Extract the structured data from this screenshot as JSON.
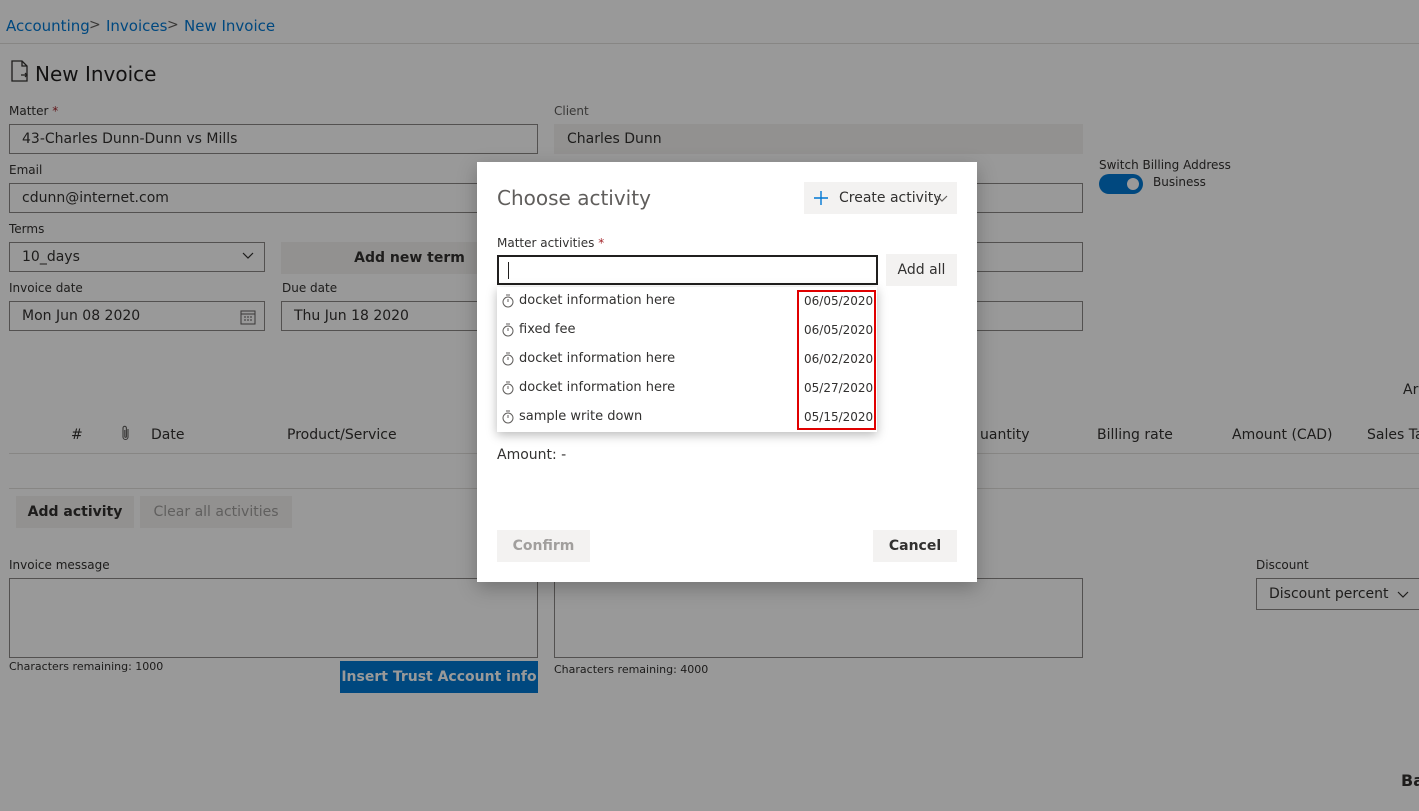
{
  "breadcrumb": {
    "items": [
      "Accounting",
      "Invoices",
      "New Invoice"
    ],
    "separator": ">"
  },
  "page": {
    "title": "New Invoice",
    "title_icon": "document-icon"
  },
  "form": {
    "matter": {
      "label": "Matter",
      "required_mark": "*",
      "value": "43-Charles Dunn-Dunn vs Mills"
    },
    "client": {
      "label": "Client",
      "value": "Charles Dunn"
    },
    "email": {
      "label": "Email",
      "value": "cdunn@internet.com"
    },
    "switch_billing": {
      "label": "Switch Billing Address",
      "state_label": "Business"
    },
    "terms": {
      "label": "Terms",
      "value": "10_days",
      "add_label": "Add new term"
    },
    "invoice_date": {
      "label": "Invoice date",
      "value": "Mon Jun 08 2020"
    },
    "due_date": {
      "label": "Due date",
      "value": "Thu Jun 18 2020"
    }
  },
  "table": {
    "columns": [
      "#",
      "Date",
      "Product/Service",
      "Quantity",
      "Billing rate",
      "Amount (CAD)",
      "Sales Tax"
    ],
    "cut_column_text": "Ar",
    "quantity_fragment": "uantity",
    "salestax_fragment": "Sales Tax"
  },
  "actions": {
    "add_activity": "Add activity",
    "clear_all": "Clear all activities"
  },
  "invoice_message": {
    "label": "Invoice message",
    "remaining": "Characters remaining: 1000"
  },
  "statement": {
    "remaining": "Characters remaining: 4000"
  },
  "insert_trust": "Insert Trust Account info",
  "discount": {
    "label": "Discount",
    "value": "Discount percent"
  },
  "bottom_right_fragment": "Ba",
  "dialog": {
    "title": "Choose activity",
    "create_label": "Create activity",
    "field_label": "Matter activities",
    "required_mark": "*",
    "search_value": "",
    "add_all": "Add all",
    "amount_label": "Amount: -",
    "confirm": "Confirm",
    "cancel": "Cancel",
    "activities": [
      {
        "name": "docket information here",
        "date": "06/05/2020"
      },
      {
        "name": "fixed fee",
        "date": "06/05/2020"
      },
      {
        "name": "docket information here",
        "date": "06/02/2020"
      },
      {
        "name": "docket information here",
        "date": "05/27/2020"
      },
      {
        "name": "sample write down",
        "date": "05/15/2020"
      }
    ]
  },
  "colors": {
    "accent": "#0078d4",
    "highlight": "#e00000"
  }
}
